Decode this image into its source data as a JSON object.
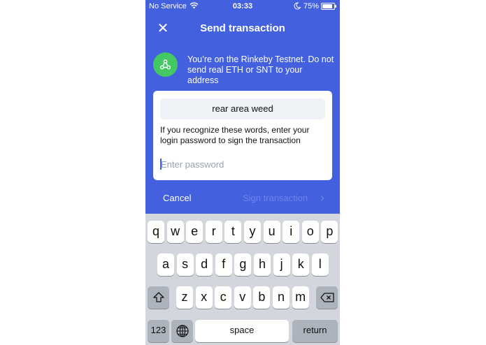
{
  "status_bar": {
    "carrier": "No Service",
    "wifi_icon": "wifi-icon",
    "time": "03:33",
    "moon_icon": "moon-icon",
    "battery_percent": "75%",
    "battery_level": 0.75
  },
  "header": {
    "close_icon": "close-icon",
    "close_glyph": "✕",
    "title": "Send transaction"
  },
  "notice": {
    "icon": "testnet-icon",
    "text": "You’re on the Rinkeby Testnet. Do not send real ETH or SNT to your address"
  },
  "card": {
    "phrase": "rear area weed",
    "instructions": "If you recognize these words, enter your login password to sign the transaction",
    "password_placeholder": "Enter password",
    "password_value": ""
  },
  "actions": {
    "cancel_label": "Cancel",
    "sign_label": "Sign transaction",
    "chevron_glyph": "›"
  },
  "keyboard": {
    "row1": [
      "q",
      "w",
      "e",
      "r",
      "t",
      "y",
      "u",
      "i",
      "o",
      "p"
    ],
    "row2": [
      "a",
      "s",
      "d",
      "f",
      "g",
      "h",
      "j",
      "k",
      "l"
    ],
    "row3": [
      "z",
      "x",
      "c",
      "v",
      "b",
      "n",
      "m"
    ],
    "shift_icon": "shift-icon",
    "backspace_icon": "backspace-icon",
    "numbers_label": "123",
    "globe_icon": "globe-icon",
    "space_label": "space",
    "return_label": "return"
  },
  "colors": {
    "accent_blue": "#4360df",
    "notice_green": "#44c864",
    "keyboard_bg": "#d3d6dc",
    "function_key": "#adb3bc"
  }
}
